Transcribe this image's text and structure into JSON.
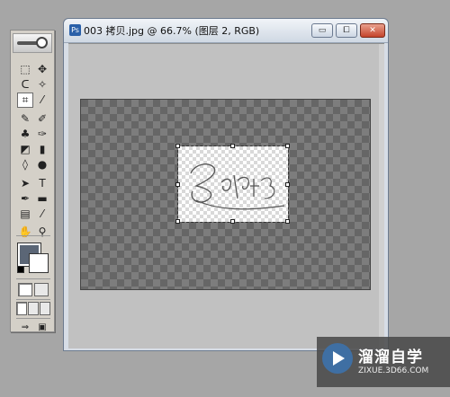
{
  "document": {
    "title": "003 拷贝.jpg @ 66.7% (图层 2, RGB)",
    "icon": "ps-document-icon",
    "buttons": {
      "minimize": "▭",
      "restore": "⧠",
      "close": "✕"
    }
  },
  "toolbox": {
    "tools": [
      {
        "name": "marquee-tool-icon",
        "glyph": "⬚"
      },
      {
        "name": "move-tool-icon",
        "glyph": "✥"
      },
      {
        "name": "lasso-tool-icon",
        "glyph": "ᑕ"
      },
      {
        "name": "magic-wand-icon",
        "glyph": "✧"
      },
      {
        "name": "crop-tool-icon",
        "glyph": "⌗"
      },
      {
        "name": "slice-tool-icon",
        "glyph": "⁄"
      },
      {
        "name": "healing-brush-icon",
        "glyph": "✎"
      },
      {
        "name": "brush-tool-icon",
        "glyph": "✐"
      },
      {
        "name": "clone-stamp-icon",
        "glyph": "♣"
      },
      {
        "name": "history-brush-icon",
        "glyph": "✑"
      },
      {
        "name": "eraser-tool-icon",
        "glyph": "◩"
      },
      {
        "name": "gradient-tool-icon",
        "glyph": "▮"
      },
      {
        "name": "blur-tool-icon",
        "glyph": "◊"
      },
      {
        "name": "dodge-tool-icon",
        "glyph": "●"
      },
      {
        "name": "path-select-icon",
        "glyph": "➤"
      },
      {
        "name": "type-tool-icon",
        "glyph": "T"
      },
      {
        "name": "pen-tool-icon",
        "glyph": "✒"
      },
      {
        "name": "shape-tool-icon",
        "glyph": "▬"
      },
      {
        "name": "notes-tool-icon",
        "glyph": "▤"
      },
      {
        "name": "eyedropper-icon",
        "glyph": "⁄"
      },
      {
        "name": "hand-tool-icon",
        "glyph": "✋"
      },
      {
        "name": "zoom-tool-icon",
        "glyph": "⚲"
      }
    ],
    "colors": {
      "foreground": "#5b6676",
      "background": "#ffffff"
    }
  },
  "watermark": {
    "name": "溜溜自学",
    "url": "ZIXUE.3D66.COM"
  }
}
